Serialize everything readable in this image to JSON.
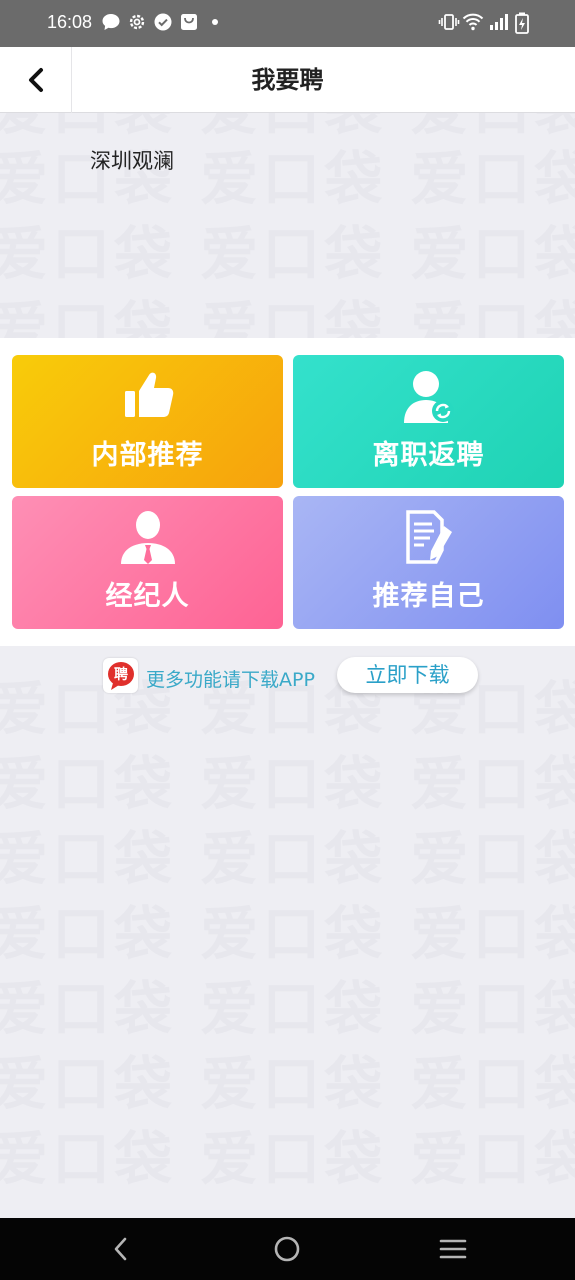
{
  "status_bar": {
    "time": "16:08",
    "left_icons": [
      "chat-bubble-icon",
      "gear-icon",
      "check-circle-icon",
      "shopping-bag-icon",
      "dot-icon"
    ],
    "right_icons": [
      "vibrate-icon",
      "wifi-icon",
      "signal-icon",
      "battery-charging-icon"
    ]
  },
  "header": {
    "title": "我要聘",
    "back_icon": "chevron-left-icon"
  },
  "company": {
    "name": "深圳观澜"
  },
  "watermark": {
    "text": "爱口袋"
  },
  "actions": [
    {
      "label": "内部推荐",
      "icon": "thumbs-up-icon",
      "color": "#f7b30c"
    },
    {
      "label": "离职返聘",
      "icon": "user-refresh-icon",
      "color": "#27d9c0"
    },
    {
      "label": "经纪人",
      "icon": "user-tie-icon",
      "color": "#fe77a4"
    },
    {
      "label": "推荐自己",
      "icon": "document-edit-icon",
      "color": "#95a3f3"
    }
  ],
  "download": {
    "tip": "更多功能请下载APP",
    "button_label": "立即下载",
    "logo_char": "聘",
    "logo_color": "#e0302c"
  },
  "nav": {
    "buttons": [
      "back-nav-icon",
      "home-nav-icon",
      "menu-nav-icon"
    ]
  }
}
